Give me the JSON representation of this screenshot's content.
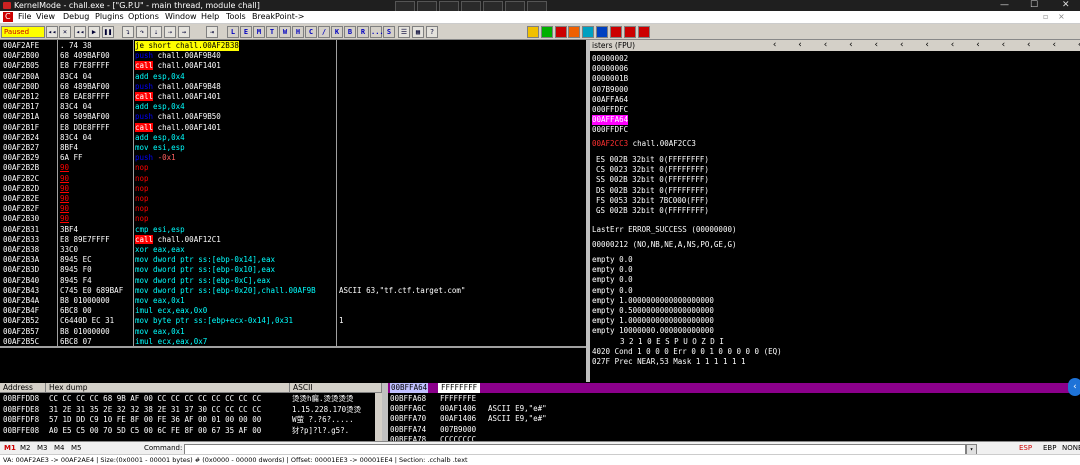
{
  "titlebar": {
    "title": "KernelMode - chall.exe - [\"G.P.U\" - main thread, module chall]",
    "min": "—",
    "max": "☐",
    "close": "✕"
  },
  "menu": {
    "icon": "C",
    "items": [
      "File",
      "View",
      "Debug",
      "Plugins",
      "Options",
      "Window",
      "Help",
      "Tools",
      "BreakPoint->"
    ]
  },
  "toolbar": {
    "status": "Paused",
    "letters": [
      "L",
      "E",
      "M",
      "T",
      "W",
      "H",
      "C",
      "/",
      "K",
      "B",
      "R",
      "...",
      "S"
    ]
  },
  "cpu": {
    "rows": [
      {
        "addr": "00AF2AFE",
        "hex": ". 74 38",
        "dis": "je short chall.00AF2B38",
        "kind": "je",
        "com": ""
      },
      {
        "addr": "00AF2B00",
        "hex": "68 409BAF00",
        "dis": "push chall.00AF9B40",
        "kind": "push",
        "com": ""
      },
      {
        "addr": "00AF2B05",
        "hex": "E8 F7E8FFFF",
        "dis": "call chall.00AF1401",
        "kind": "call",
        "com": ""
      },
      {
        "addr": "00AF2B0A",
        "hex": "83C4 04",
        "dis": "add esp,0x4",
        "kind": "arith",
        "com": ""
      },
      {
        "addr": "00AF2B0D",
        "hex": "68 489BAF00",
        "dis": "push chall.00AF9B48",
        "kind": "push",
        "com": ""
      },
      {
        "addr": "00AF2B12",
        "hex": "E8 EAE8FFFF",
        "dis": "call chall.00AF1401",
        "kind": "call",
        "com": ""
      },
      {
        "addr": "00AF2B17",
        "hex": "83C4 04",
        "dis": "add esp,0x4",
        "kind": "arith",
        "com": ""
      },
      {
        "addr": "00AF2B1A",
        "hex": "68 509BAF00",
        "dis": "push chall.00AF9B50",
        "kind": "push",
        "com": ""
      },
      {
        "addr": "00AF2B1F",
        "hex": "E8 DDE8FFFF",
        "dis": "call chall.00AF1401",
        "kind": "call",
        "com": ""
      },
      {
        "addr": "00AF2B24",
        "hex": "83C4 04",
        "dis": "add esp,0x4",
        "kind": "arith",
        "com": ""
      },
      {
        "addr": "00AF2B27",
        "hex": "8BF4",
        "dis": "mov esi,esp",
        "kind": "mov",
        "com": ""
      },
      {
        "addr": "00AF2B29",
        "hex": "6A FF",
        "dis": "push -0x1",
        "kind": "push",
        "com": ""
      },
      {
        "addr": "00AF2B2B",
        "hex": "90",
        "dis": "nop",
        "kind": "nop",
        "com": ""
      },
      {
        "addr": "00AF2B2C",
        "hex": "90",
        "dis": "nop",
        "kind": "nop",
        "com": ""
      },
      {
        "addr": "00AF2B2D",
        "hex": "90",
        "dis": "nop",
        "kind": "nop",
        "com": ""
      },
      {
        "addr": "00AF2B2E",
        "hex": "90",
        "dis": "nop",
        "kind": "nop",
        "com": ""
      },
      {
        "addr": "00AF2B2F",
        "hex": "90",
        "dis": "nop",
        "kind": "nop",
        "com": ""
      },
      {
        "addr": "00AF2B30",
        "hex": "90",
        "dis": "nop",
        "kind": "nop",
        "com": ""
      },
      {
        "addr": "00AF2B31",
        "hex": "3BF4",
        "dis": "cmp esi,esp",
        "kind": "cmp",
        "com": ""
      },
      {
        "addr": "00AF2B33",
        "hex": "E8 89E7FFFF",
        "dis": "call chall.00AF12C1",
        "kind": "call",
        "com": ""
      },
      {
        "addr": "00AF2B38",
        "hex": "33C0",
        "dis": "xor eax,eax",
        "kind": "arith",
        "com": ""
      },
      {
        "addr": "00AF2B3A",
        "hex": "8945 EC",
        "dis": "mov dword ptr ss:[ebp-0x14],eax",
        "kind": "mov",
        "com": ""
      },
      {
        "addr": "00AF2B3D",
        "hex": "8945 F0",
        "dis": "mov dword ptr ss:[ebp-0x10],eax",
        "kind": "mov",
        "com": ""
      },
      {
        "addr": "00AF2B40",
        "hex": "8945 F4",
        "dis": "mov dword ptr ss:[ebp-0xC],eax",
        "kind": "mov",
        "com": ""
      },
      {
        "addr": "00AF2B43",
        "hex": "C745 E0 689BAF",
        "dis": "mov dword ptr ss:[ebp-0x20],chall.00AF9B",
        "kind": "mov",
        "com": "ASCII 63,\"tf.ctf.target.com\""
      },
      {
        "addr": "00AF2B4A",
        "hex": "B8 01000000",
        "dis": "mov eax,0x1",
        "kind": "mov",
        "com": ""
      },
      {
        "addr": "00AF2B4F",
        "hex": "6BC8 00",
        "dis": "imul ecx,eax,0x0",
        "kind": "arith",
        "com": ""
      },
      {
        "addr": "00AF2B52",
        "hex": "C6440D EC 31",
        "dis": "mov byte ptr ss:[ebp+ecx-0x14],0x31",
        "kind": "mov",
        "com": "1"
      },
      {
        "addr": "00AF2B57",
        "hex": "B8 01000000",
        "dis": "mov eax,0x1",
        "kind": "mov",
        "com": ""
      },
      {
        "addr": "00AF2B5C",
        "hex": "6BC8 07",
        "dis": "imul ecx,eax,0x7",
        "kind": "arith",
        "com": ""
      }
    ]
  },
  "registers": {
    "title": "isters (FPU)",
    "stack_vals": [
      "00000002",
      "00000006",
      "0000001B",
      "007B9000",
      "00AFFA64",
      "000FFDFC",
      "00AFFA64",
      "000FFDFC"
    ],
    "eip": "00AF2CC3 chall.00AF2CC3",
    "segments": [
      "ES 002B 32bit 0(FFFFFFFF)",
      "CS 0023 32bit 0(FFFFFFFF)",
      "SS 002B 32bit 0(FFFFFFFF)",
      "DS 002B 32bit 0(FFFFFFFF)",
      "FS 0053 32bit 7BC000(FFF)",
      "GS 002B 32bit 0(FFFFFFFF)"
    ],
    "lasterr": "LastErr ERROR_SUCCESS (00000000)",
    "efl": "00000212 (NO,NB,NE,A,NS,PO,GE,G)",
    "fpu": [
      "empty 0.0",
      "empty 0.0",
      "empty 0.0",
      "empty 0.0",
      "empty 1.0000000000000000000",
      "empty 0.5000000000000000000",
      "empty 1.0000000000000000000",
      "empty 10000000.000000000000"
    ],
    "flags_header": "3 2 1 0      E S P U O Z D I",
    "cond": "4020  Cond 1 0 0 0  Err 0 0 1 0 0 0 0 0  (EQ)",
    "prec": "027F  Prec NEAR,53  Mask    1 1 1 1 1 1"
  },
  "dump": {
    "headers": [
      "Address",
      "Hex dump",
      "ASCII"
    ],
    "rows": [
      {
        "addr": "00BFFDD8",
        "hex": "CC CC CC CC 68 9B AF 00 CC CC CC CC CC CC CC CC",
        "ascii": "烫烫h瘺.烫烫烫烫"
      },
      {
        "addr": "00BFFDE8",
        "hex": "31 2E 31 35 2E 32 32 38 2E 31 37 30 CC CC CC CC",
        "ascii": "1.15.228.170烫烫"
      },
      {
        "addr": "00BFFDF8",
        "hex": "57 1D DD C9 10 FE 8F 00 FE 36 AF 00 01 00 00 00",
        "ascii": "W萤 ?.?6?....."
      },
      {
        "addr": "00BFFE08",
        "hex": "A0 E5 C5 00 70 5D C5 00 6C FE 8F 00 67 35 AF 00",
        "ascii": "犲?p]?l?.g5?."
      }
    ]
  },
  "stack": {
    "top_addr": "00BFFA64",
    "top_val": "FFFFFFFF",
    "rows": [
      {
        "addr": "00BFFA68",
        "val": "FFFFFFFE",
        "com": ""
      },
      {
        "addr": "00BFFA6C",
        "val": "00AF1406",
        "com": "ASCII E9,\"e#\""
      },
      {
        "addr": "00BFFA70",
        "val": "00AF1406",
        "com": "ASCII E9,\"e#\""
      },
      {
        "addr": "00BFFA74",
        "val": "007B9000",
        "com": ""
      },
      {
        "addr": "00BFFA78",
        "val": "CCCCCCCC",
        "com": ""
      }
    ]
  },
  "cmdbar": {
    "tabs": [
      "M1",
      "M2",
      "M3",
      "M4",
      "M5"
    ],
    "command_label": "Command:",
    "reg_buttons": [
      "ESP",
      "EBP",
      "NONE"
    ]
  },
  "status": "VA: 00AF2AE3 -> 00AF2AE4  |  Size:(0x0001 - 00001 bytes)  #  (0x0000 - 00000 dwords)  |  Offset: 00001EE3 -> 00001EE4  |  Section: .cchalb .text",
  "colors": {
    "push": "#ff6060",
    "call_bg": "#ff0000",
    "call_fg": "#ffffff",
    "mov": "#00ffff",
    "cmp": "#00ffff",
    "nop": "#ff0000",
    "arith": "#00ffff",
    "je_bg": "#ffff00",
    "je_fg": "#000000",
    "magenta": "#ff00ff",
    "stack_hdr": "#8b008b"
  }
}
